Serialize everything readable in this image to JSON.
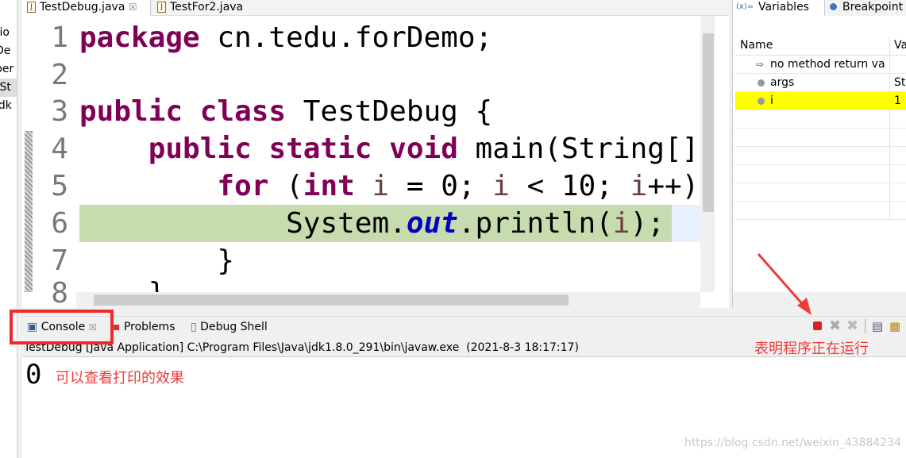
{
  "left_strip": [
    "tio",
    "De",
    "per",
    "(St",
    "jdk"
  ],
  "editor_tabs": [
    {
      "label": "TestDebug.java",
      "active": true
    },
    {
      "label": "TestFor2.java",
      "active": false
    }
  ],
  "code": {
    "lines": [
      {
        "n": "1",
        "html_parts": [
          [
            "kw",
            "package"
          ],
          [
            "",
            "  cn.tedu.forDemo;"
          ]
        ]
      },
      {
        "n": "2",
        "html_parts": []
      },
      {
        "n": "3",
        "html_parts": [
          [
            "kw",
            "public"
          ],
          [
            "",
            " "
          ],
          [
            "kw",
            "class"
          ],
          [
            "",
            " TestDebug {"
          ]
        ]
      },
      {
        "n": "4",
        "html_parts": [
          [
            "",
            " "
          ],
          [
            "kw",
            "public"
          ],
          [
            "",
            " "
          ],
          [
            "kw",
            "static"
          ],
          [
            "",
            " "
          ],
          [
            "kw",
            "void"
          ],
          [
            "",
            " main(String[]"
          ]
        ]
      },
      {
        "n": "5",
        "html_parts": []
      },
      {
        "n": "6",
        "html_parts": []
      },
      {
        "n": "7",
        "html_parts": []
      },
      {
        "n": "8",
        "html_parts": []
      }
    ]
  },
  "code_text": {
    "l1a": "package",
    "l1b": " cn.tedu.forDemo;",
    "l3a": "public",
    "l3b": " ",
    "l3c": "class",
    "l3d": " TestDebug {",
    "l4a": "public",
    "l4c": "static",
    "l4e": "void",
    "l4f": " main(String[]",
    "l5a": "for",
    "l5b": " (",
    "l5c": "int",
    "l5d": " ",
    "l5e": "i",
    "l5f": " = 0; ",
    "l5g": "i",
    "l5h": " < 10; ",
    "l5i": "i",
    "l5j": "++)",
    "l6a": "System.",
    "l6b": "out",
    "l6c": ".println(",
    "l6d": "i",
    "l6e": ");",
    "l7": "}",
    "l8": "}"
  },
  "right_panel": {
    "tabs": [
      {
        "label": "Variables",
        "icon": "(x)="
      },
      {
        "label": "Breakpoint"
      }
    ],
    "columns": [
      "Name",
      "Va"
    ],
    "rows": [
      {
        "name": "no method return va",
        "value": ""
      },
      {
        "name": "args",
        "value": "St"
      },
      {
        "name": "i",
        "value": "1",
        "highlighted": true
      }
    ]
  },
  "console": {
    "tabs": [
      "Console",
      "Problems",
      "Debug Shell"
    ],
    "launch": "TestDebug [Java Application] C:\\Program Files\\Java\\jdk1.8.0_291\\bin\\javaw.exe  (2021-8-3 18:17:17)",
    "output": "0"
  },
  "annotations": {
    "output_note": "可以查看打印的效果",
    "running_note": "表明程序正在运行",
    "color": "#f03a3a"
  },
  "watermark": "https://blog.csdn.net/weixin_43884234"
}
